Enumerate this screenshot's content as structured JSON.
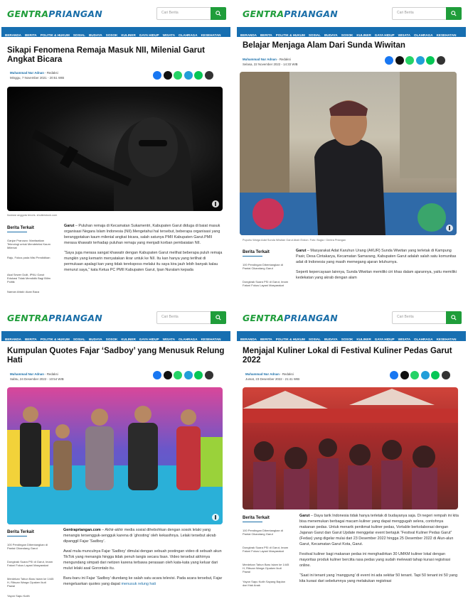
{
  "brand": {
    "part1": "GENTRA",
    "part2": "PRIANGAN"
  },
  "search": {
    "placeholder": "Cari Berita"
  },
  "nav": [
    "BERANDA",
    "BERITA",
    "POLITIK & HUKUM",
    "SOSIAL",
    "BUDAYA",
    "SOSOK",
    "KULINER",
    "GAYA HIDUP",
    "WISATA",
    "OLAHRAGA",
    "KESEHATAN"
  ],
  "colors": {
    "brand_green": "#1f9d3a",
    "brand_blue": "#176fb1"
  },
  "share_icons": [
    "facebook-icon",
    "x-icon",
    "whatsapp-icon",
    "telegram-icon",
    "line-icon",
    "link-icon"
  ],
  "articles": [
    {
      "title": "Sikapi Fenomena Remaja Masuk NII, Milenial Garut Angkat Bicara",
      "author": "Muhammad Nur Adnan",
      "role": "Redaksi",
      "date": "Minggu, 7 November 2021 - 20:51 WIB",
      "caption": "Ilustrasi anggota teroris. shutterstock.com",
      "trending": [
        "Ganjar Pranowo: Manfaatkan Teknologi untuk Mendeteksi Kaum Milenial",
        "Raju, Fokus pada Misi Pendidikan",
        "Akal Sewer Dulit, IPNU Garut Edukasi Tidak Mendidik Bagi Bilim Politik",
        "Naman Attaki: Akan Baca"
      ],
      "paragraphs": [
        {
          "lead": "Garut",
          "text": " – Puluhan remaja di Kecamatan Sukamentri, Kabupaten Garut diduga di baiat masuk organisasi Negara Islam Indonesia (NII).Mengetahui hal tersebut, beberapa organisasi yang beranggotakan kaum milenial angkat bicara, salah satunya PMII Kabupaten Garut.PMII merasa khawatir terhadap puluhan remaja yang menjadi korban pembaiatan NII."
        },
        {
          "lead": "",
          "text": "“Saya juga merasa sangat khawatir dengan Kabupaten Garut melihat beberapa puluh remaja mungkin yang kemarin menyatakan ikrar untuk ke NII. Itu kan hanya yang terlihat di permukaan apalagi kan yang tidak tereksposs melalui itu saya kira jauh lebih banyak kalau menurut saya,” kata Ketua PC PMII Kabupaten Garut, Ipan Nuralam kepada"
        }
      ]
    },
    {
      "title": "Belajar Menjaga Alam Dari Sunda Wiwitan",
      "author": "Muhammad Nur Adnan",
      "role": "Redaksi",
      "date": "Selasa, 22 November 2022 - 14:33 WIB",
      "caption": "Pupuhu Warga Adat Sunda Wiwitan Garut Abah Endon. Foto: Bugia / Gentra Priangan",
      "trending": [
        "100 Pendingan Dibentangkan di Pantai Cikandang Garut",
        "Dongkrak Suara PSI di Garut, Imam Fatoni Fokus Layani Masyarakat"
      ],
      "paragraphs": [
        {
          "lead": "Garut",
          "text": " – Masyarakat Adat Karuhun Urang (AKUR) Sunda Wiwitan yang terletak di Kampung Pasir, Desa Cintakarya, Kecamatan Samarang, Kabupaten Garut adalah salah satu komunitas adat di Indonesia yang masih memegang ajaran leluhurnya."
        },
        {
          "lead": "",
          "text": "Seperti kepercayaan lainnya, Sunda Wiwitan memiliki ciri khas dalam ajarannya, yaitu memiliki kedekatan yang akrab dengan alam"
        }
      ]
    },
    {
      "title": "Kumpulan Quotes Fajar ‘Sadboy’ yang Menusuk Relung Hati",
      "author": "Muhammad Nur Adnan",
      "role": "Redaksi",
      "date": "Sabtu, 24 Desember 2022 - 10:54 WIB",
      "caption": "",
      "trending": [
        "100 Pendingan Dibentangkan di Pantai Cikandang Garut",
        "Dongkrak Suara PSI di Garut, Imam Fatoni Fokus Layani Masyarakat",
        "Merdekan Tahun Baru Islam ke 1445 H, Ribuan Warga Cipaken Ikuti Pawai",
        "Yayon Sapu Kutih"
      ],
      "paragraphs": [
        {
          "lead": "Gentrapriangan.com",
          "text": " – Akhir-akhir media sosial dihebohkan dengan sosok lelaki yang menangis tersengguk-sengguk karena di ‘ghosting’ oleh kekasihnya. Lelaki tersebut akrab dipanggil Fajar ‘Sadboy’."
        },
        {
          "lead": "",
          "text": "Awal mula munculnya Fajar ‘Sadboy’ dimulai dengan sebuah postingan video di sebuah akun TikTok yang menangis hingga tidak penuh tangis secara lisan. Video tersebut akhirnya mengundang simpati dari netizen karena terbawa perasaan oleh kata-kata yang keluar dari mulut lelaki asal Gorontalo itu."
        },
        {
          "lead": "",
          "text": "Baru-baru ini Fajar ‘Sadboy’ diundang ke salah satu acara televisi. Pada acara tersebut, Fajar mengeluarkan quotes yang dapat ",
          "link": "menusuk relung hati"
        }
      ]
    },
    {
      "title": "Menjajal Kuliner Lokal di Festival Kuliner Pedas Garut 2022",
      "author": "Muhammad Nur Adnan",
      "role": "Redaksi",
      "date": "Jumat, 23 Desember 2022 - 21:41 WIB",
      "caption": "",
      "trending": [
        "100 Pendingan Dibentangkan di Pantai Cikandang Garut",
        "Dongkrak Suara PSI di Garut, Imam Fatoni Fokus Layani Masyarakat",
        "Merdekan Tahun Baru Islam ke 1445 H, Ribuan Warga Cipaken Ikuti Pawai",
        "Yayon Sapu Kutih Sayang Baplan dari Hak Anak"
      ],
      "paragraphs": [
        {
          "lead": "Garut",
          "text": " – Daya tarik Indonesia tidak hanya terletak di budayanya saja. Di negeri rempah ini kita bisa menemukan berbagai macam kuliner yang dapat menggugah selera, contohnya makanan pedas. Untuk menarik penikmat kuliner pedas, Vortable berkolaborasi dengan Jajanan Garut dan Garut Update menggelar event bertajuk “Festival Kuliner Pedas Garut” (Fedas) yang digelar mulai dari 23 Desember 2022 hingga 25 Desember 2022 di Alun-alun Garut, Kecamatan Garut Kota, Garut."
        },
        {
          "lead": "",
          "text": "Festival kuliner bagi makanan pedas ini menghadirkan 30 UMKM kuliner lokal dengan mayoritas produk kuliner berciita rasa pedas yang sudah melewati tahap kurasi registrasi online."
        },
        {
          "lead": "",
          "text": "“Saat ini tenant yang ‘manggung’ di event ini ada sekitar 50 tenant. Tapi 50 tenant ini 50 yang kita kurasi dari sebelumnya yang melakukan registrasi"
        }
      ]
    }
  ]
}
